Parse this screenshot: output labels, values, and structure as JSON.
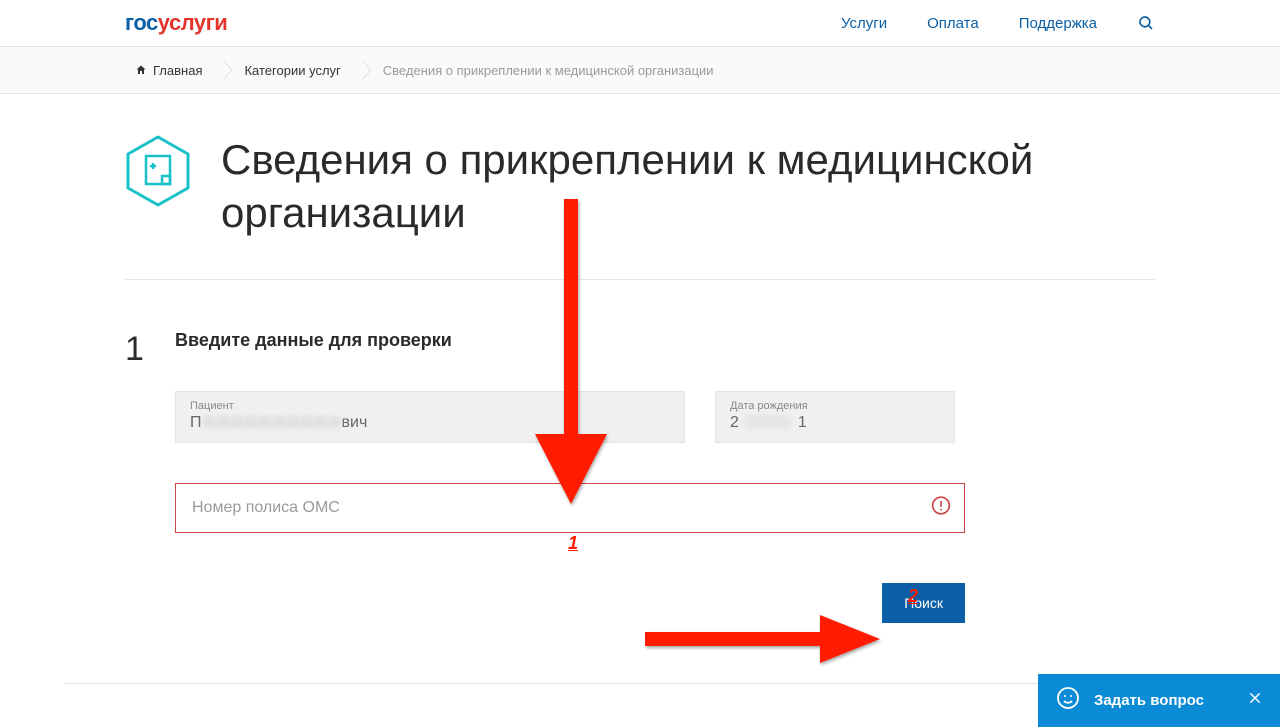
{
  "logo": {
    "part1": "гос",
    "part2": "услуги"
  },
  "nav": {
    "services": "Услуги",
    "payment": "Оплата",
    "support": "Поддержка"
  },
  "breadcrumbs": {
    "home": "Главная",
    "categories": "Категории услуг",
    "current": "Сведения о прикреплении к медицинской организации"
  },
  "page": {
    "title": "Сведения о прикреплении к медицинской организации"
  },
  "step": {
    "number": "1",
    "title": "Введите данные для проверки"
  },
  "fields": {
    "patient_label": "Пациент",
    "patient_before": "П",
    "patient_after": "вич",
    "dob_label": "Дата рождения",
    "dob_before": "2",
    "dob_after": "1",
    "oms_placeholder": "Номер полиса ОМС"
  },
  "buttons": {
    "search": "Поиск"
  },
  "annotations": {
    "label1": "1",
    "label2": "2"
  },
  "chat": {
    "label": "Задать вопрос"
  }
}
